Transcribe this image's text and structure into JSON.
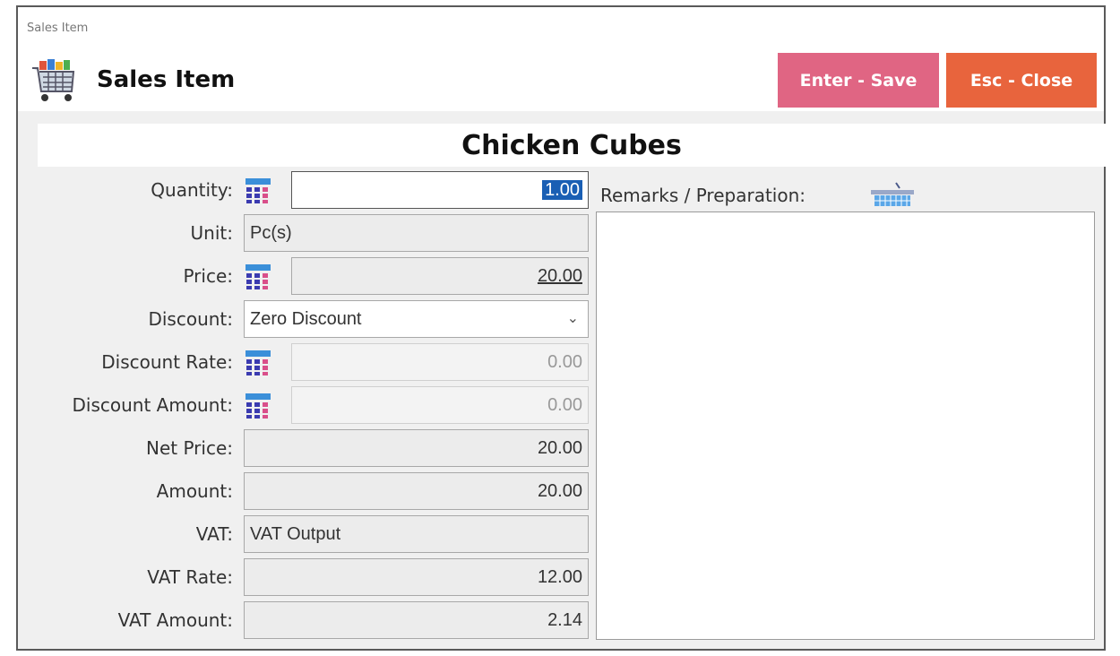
{
  "window": {
    "small_title": "Sales Item"
  },
  "header": {
    "title": "Sales Item",
    "app_icon": "shopping-cart-icon",
    "save_label": "Enter - Save",
    "close_label": "Esc - Close",
    "save_color": "#e06583",
    "close_color": "#e8643d"
  },
  "item": {
    "name": "Chicken Cubes"
  },
  "form": {
    "quantity": {
      "label": "Quantity:",
      "value": "1.00",
      "icon": "calculator-icon"
    },
    "unit": {
      "label": "Unit:",
      "value": "Pc(s)"
    },
    "price": {
      "label": "Price:",
      "value": "20.00",
      "icon": "calculator-icon"
    },
    "discount": {
      "label": "Discount:",
      "value": "Zero Discount"
    },
    "discount_rate": {
      "label": "Discount Rate:",
      "value": "0.00",
      "icon": "calculator-icon"
    },
    "discount_amount": {
      "label": "Discount Amount:",
      "value": "0.00",
      "icon": "calculator-icon"
    },
    "net_price": {
      "label": "Net Price:",
      "value": "20.00"
    },
    "amount": {
      "label": "Amount:",
      "value": "20.00"
    },
    "vat": {
      "label": "VAT:",
      "value": "VAT Output"
    },
    "vat_rate": {
      "label": "VAT Rate:",
      "value": "12.00"
    },
    "vat_amount": {
      "label": "VAT Amount:",
      "value": "2.14"
    }
  },
  "remarks": {
    "label": "Remarks / Preparation:",
    "icon": "keyboard-icon",
    "value": ""
  }
}
